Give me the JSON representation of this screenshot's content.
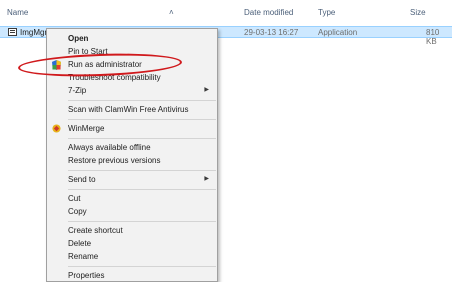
{
  "header": {
    "name": "Name",
    "date_modified": "Date modified",
    "type": "Type",
    "size": "Size"
  },
  "file_row": {
    "name": "ImgMgr",
    "date": "29-03-13 16:27",
    "type": "Application",
    "size": "810 KB"
  },
  "menu": {
    "open": "Open",
    "pin_to_start": "Pin to Start",
    "run_as_admin": "Run as administrator",
    "troubleshoot": "Troubleshoot compatibility",
    "seven_zip": "7-Zip",
    "scan_clamwin": "Scan with ClamWin Free Antivirus",
    "winmerge": "WinMerge",
    "always_offline": "Always available offline",
    "restore_versions": "Restore previous versions",
    "send_to": "Send to",
    "cut": "Cut",
    "copy": "Copy",
    "create_shortcut": "Create shortcut",
    "delete": "Delete",
    "rename": "Rename",
    "properties": "Properties"
  },
  "colors": {
    "selection": "#cde8ff",
    "highlight_ellipse": "#d0191c"
  }
}
